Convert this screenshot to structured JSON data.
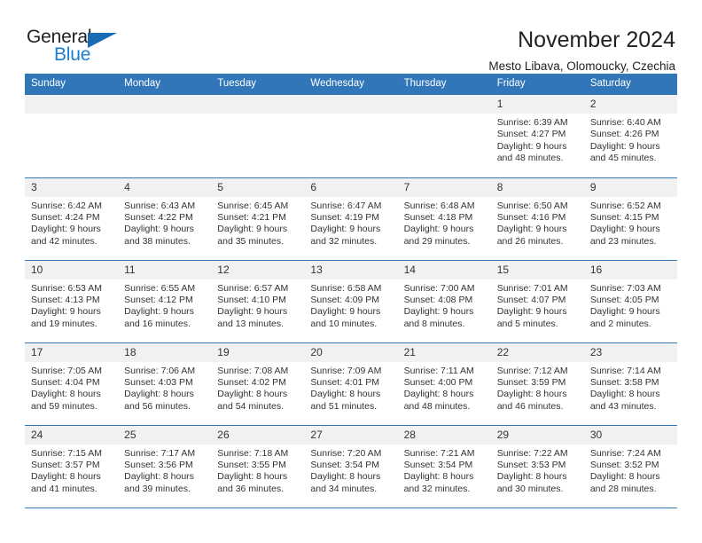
{
  "brand": {
    "name_top": "General",
    "name_bottom": "Blue",
    "color_dark": "#231f20",
    "color_blue": "#1a7fd4",
    "triangle_color": "#1a6bb5"
  },
  "header": {
    "month_title": "November 2024",
    "location": "Mesto Libava, Olomoucky, Czechia"
  },
  "theme": {
    "header_bg": "#3176b8",
    "header_text": "#ffffff",
    "daynum_bg": "#f1f1f1",
    "grid_line": "#3176b8"
  },
  "weekday_headers": [
    "Sunday",
    "Monday",
    "Tuesday",
    "Wednesday",
    "Thursday",
    "Friday",
    "Saturday"
  ],
  "weeks": [
    [
      {
        "day": "",
        "empty": true,
        "sunrise": "",
        "sunset": "",
        "daylight1": "",
        "daylight2": ""
      },
      {
        "day": "",
        "empty": true,
        "sunrise": "",
        "sunset": "",
        "daylight1": "",
        "daylight2": ""
      },
      {
        "day": "",
        "empty": true,
        "sunrise": "",
        "sunset": "",
        "daylight1": "",
        "daylight2": ""
      },
      {
        "day": "",
        "empty": true,
        "sunrise": "",
        "sunset": "",
        "daylight1": "",
        "daylight2": ""
      },
      {
        "day": "",
        "empty": true,
        "sunrise": "",
        "sunset": "",
        "daylight1": "",
        "daylight2": ""
      },
      {
        "day": "1",
        "empty": false,
        "sunrise": "Sunrise: 6:39 AM",
        "sunset": "Sunset: 4:27 PM",
        "daylight1": "Daylight: 9 hours",
        "daylight2": "and 48 minutes."
      },
      {
        "day": "2",
        "empty": false,
        "sunrise": "Sunrise: 6:40 AM",
        "sunset": "Sunset: 4:26 PM",
        "daylight1": "Daylight: 9 hours",
        "daylight2": "and 45 minutes."
      }
    ],
    [
      {
        "day": "3",
        "empty": false,
        "sunrise": "Sunrise: 6:42 AM",
        "sunset": "Sunset: 4:24 PM",
        "daylight1": "Daylight: 9 hours",
        "daylight2": "and 42 minutes."
      },
      {
        "day": "4",
        "empty": false,
        "sunrise": "Sunrise: 6:43 AM",
        "sunset": "Sunset: 4:22 PM",
        "daylight1": "Daylight: 9 hours",
        "daylight2": "and 38 minutes."
      },
      {
        "day": "5",
        "empty": false,
        "sunrise": "Sunrise: 6:45 AM",
        "sunset": "Sunset: 4:21 PM",
        "daylight1": "Daylight: 9 hours",
        "daylight2": "and 35 minutes."
      },
      {
        "day": "6",
        "empty": false,
        "sunrise": "Sunrise: 6:47 AM",
        "sunset": "Sunset: 4:19 PM",
        "daylight1": "Daylight: 9 hours",
        "daylight2": "and 32 minutes."
      },
      {
        "day": "7",
        "empty": false,
        "sunrise": "Sunrise: 6:48 AM",
        "sunset": "Sunset: 4:18 PM",
        "daylight1": "Daylight: 9 hours",
        "daylight2": "and 29 minutes."
      },
      {
        "day": "8",
        "empty": false,
        "sunrise": "Sunrise: 6:50 AM",
        "sunset": "Sunset: 4:16 PM",
        "daylight1": "Daylight: 9 hours",
        "daylight2": "and 26 minutes."
      },
      {
        "day": "9",
        "empty": false,
        "sunrise": "Sunrise: 6:52 AM",
        "sunset": "Sunset: 4:15 PM",
        "daylight1": "Daylight: 9 hours",
        "daylight2": "and 23 minutes."
      }
    ],
    [
      {
        "day": "10",
        "empty": false,
        "sunrise": "Sunrise: 6:53 AM",
        "sunset": "Sunset: 4:13 PM",
        "daylight1": "Daylight: 9 hours",
        "daylight2": "and 19 minutes."
      },
      {
        "day": "11",
        "empty": false,
        "sunrise": "Sunrise: 6:55 AM",
        "sunset": "Sunset: 4:12 PM",
        "daylight1": "Daylight: 9 hours",
        "daylight2": "and 16 minutes."
      },
      {
        "day": "12",
        "empty": false,
        "sunrise": "Sunrise: 6:57 AM",
        "sunset": "Sunset: 4:10 PM",
        "daylight1": "Daylight: 9 hours",
        "daylight2": "and 13 minutes."
      },
      {
        "day": "13",
        "empty": false,
        "sunrise": "Sunrise: 6:58 AM",
        "sunset": "Sunset: 4:09 PM",
        "daylight1": "Daylight: 9 hours",
        "daylight2": "and 10 minutes."
      },
      {
        "day": "14",
        "empty": false,
        "sunrise": "Sunrise: 7:00 AM",
        "sunset": "Sunset: 4:08 PM",
        "daylight1": "Daylight: 9 hours",
        "daylight2": "and 8 minutes."
      },
      {
        "day": "15",
        "empty": false,
        "sunrise": "Sunrise: 7:01 AM",
        "sunset": "Sunset: 4:07 PM",
        "daylight1": "Daylight: 9 hours",
        "daylight2": "and 5 minutes."
      },
      {
        "day": "16",
        "empty": false,
        "sunrise": "Sunrise: 7:03 AM",
        "sunset": "Sunset: 4:05 PM",
        "daylight1": "Daylight: 9 hours",
        "daylight2": "and 2 minutes."
      }
    ],
    [
      {
        "day": "17",
        "empty": false,
        "sunrise": "Sunrise: 7:05 AM",
        "sunset": "Sunset: 4:04 PM",
        "daylight1": "Daylight: 8 hours",
        "daylight2": "and 59 minutes."
      },
      {
        "day": "18",
        "empty": false,
        "sunrise": "Sunrise: 7:06 AM",
        "sunset": "Sunset: 4:03 PM",
        "daylight1": "Daylight: 8 hours",
        "daylight2": "and 56 minutes."
      },
      {
        "day": "19",
        "empty": false,
        "sunrise": "Sunrise: 7:08 AM",
        "sunset": "Sunset: 4:02 PM",
        "daylight1": "Daylight: 8 hours",
        "daylight2": "and 54 minutes."
      },
      {
        "day": "20",
        "empty": false,
        "sunrise": "Sunrise: 7:09 AM",
        "sunset": "Sunset: 4:01 PM",
        "daylight1": "Daylight: 8 hours",
        "daylight2": "and 51 minutes."
      },
      {
        "day": "21",
        "empty": false,
        "sunrise": "Sunrise: 7:11 AM",
        "sunset": "Sunset: 4:00 PM",
        "daylight1": "Daylight: 8 hours",
        "daylight2": "and 48 minutes."
      },
      {
        "day": "22",
        "empty": false,
        "sunrise": "Sunrise: 7:12 AM",
        "sunset": "Sunset: 3:59 PM",
        "daylight1": "Daylight: 8 hours",
        "daylight2": "and 46 minutes."
      },
      {
        "day": "23",
        "empty": false,
        "sunrise": "Sunrise: 7:14 AM",
        "sunset": "Sunset: 3:58 PM",
        "daylight1": "Daylight: 8 hours",
        "daylight2": "and 43 minutes."
      }
    ],
    [
      {
        "day": "24",
        "empty": false,
        "sunrise": "Sunrise: 7:15 AM",
        "sunset": "Sunset: 3:57 PM",
        "daylight1": "Daylight: 8 hours",
        "daylight2": "and 41 minutes."
      },
      {
        "day": "25",
        "empty": false,
        "sunrise": "Sunrise: 7:17 AM",
        "sunset": "Sunset: 3:56 PM",
        "daylight1": "Daylight: 8 hours",
        "daylight2": "and 39 minutes."
      },
      {
        "day": "26",
        "empty": false,
        "sunrise": "Sunrise: 7:18 AM",
        "sunset": "Sunset: 3:55 PM",
        "daylight1": "Daylight: 8 hours",
        "daylight2": "and 36 minutes."
      },
      {
        "day": "27",
        "empty": false,
        "sunrise": "Sunrise: 7:20 AM",
        "sunset": "Sunset: 3:54 PM",
        "daylight1": "Daylight: 8 hours",
        "daylight2": "and 34 minutes."
      },
      {
        "day": "28",
        "empty": false,
        "sunrise": "Sunrise: 7:21 AM",
        "sunset": "Sunset: 3:54 PM",
        "daylight1": "Daylight: 8 hours",
        "daylight2": "and 32 minutes."
      },
      {
        "day": "29",
        "empty": false,
        "sunrise": "Sunrise: 7:22 AM",
        "sunset": "Sunset: 3:53 PM",
        "daylight1": "Daylight: 8 hours",
        "daylight2": "and 30 minutes."
      },
      {
        "day": "30",
        "empty": false,
        "sunrise": "Sunrise: 7:24 AM",
        "sunset": "Sunset: 3:52 PM",
        "daylight1": "Daylight: 8 hours",
        "daylight2": "and 28 minutes."
      }
    ]
  ]
}
